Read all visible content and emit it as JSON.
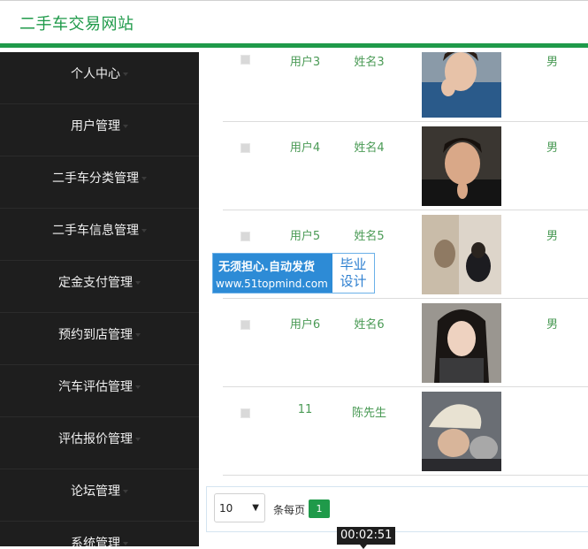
{
  "app": {
    "title": "二手车交易网站"
  },
  "sidebar": {
    "items": [
      {
        "label": "个人中心"
      },
      {
        "label": "用户管理"
      },
      {
        "label": "二手车分类管理"
      },
      {
        "label": "二手车信息管理"
      },
      {
        "label": "定金支付管理"
      },
      {
        "label": "预约到店管理"
      },
      {
        "label": "汽车评估管理"
      },
      {
        "label": "评估报价管理"
      },
      {
        "label": "论坛管理"
      },
      {
        "label": "系统管理"
      }
    ]
  },
  "table": {
    "rows": [
      {
        "account": "用户3",
        "name": "姓名3",
        "sex": "男"
      },
      {
        "account": "用户4",
        "name": "姓名4",
        "sex": "男"
      },
      {
        "account": "用户5",
        "name": "姓名5",
        "sex": "男"
      },
      {
        "account": "用户6",
        "name": "姓名6",
        "sex": "男"
      },
      {
        "account": "11",
        "name": "陈先生",
        "sex": ""
      }
    ]
  },
  "pagination": {
    "page_size": "10",
    "per_page_label": "条每页",
    "current_page": "1"
  },
  "watermark": {
    "line1": "无须担心.自动发货",
    "line2": "www.51topmind.com",
    "right1": "毕业",
    "right2": "设计"
  },
  "video": {
    "timestamp": "00:02:51"
  },
  "colors": {
    "accent": "#1f9a4a",
    "sidebar_bg": "#1e1e1e",
    "cell_text": "#4a9a55"
  }
}
